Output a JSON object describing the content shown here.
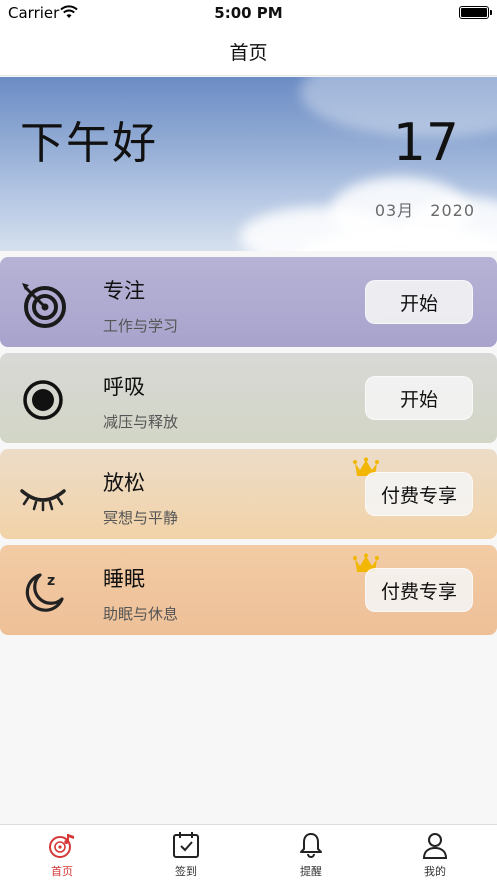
{
  "status_bar": {
    "carrier": "Carrier",
    "time": "5:00 PM"
  },
  "nav": {
    "title": "首页"
  },
  "hero": {
    "greeting": "下午好",
    "day": "17",
    "month": "03月",
    "year": "2020"
  },
  "cards": [
    {
      "title": "专注",
      "subtitle": "工作与学习",
      "button": "开始",
      "icon": "target-icon",
      "premium": false
    },
    {
      "title": "呼吸",
      "subtitle": "减压与释放",
      "button": "开始",
      "icon": "record-dot-icon",
      "premium": false
    },
    {
      "title": "放松",
      "subtitle": "冥想与平静",
      "button": "付费专享",
      "icon": "closed-eye-icon",
      "premium": true
    },
    {
      "title": "睡眠",
      "subtitle": "助眠与休息",
      "button": "付费专享",
      "icon": "moon-icon",
      "premium": true
    }
  ],
  "tabs": [
    {
      "label": "首页",
      "icon": "music-disc-icon",
      "active": true
    },
    {
      "label": "签到",
      "icon": "calendar-check-icon",
      "active": false
    },
    {
      "label": "提醒",
      "icon": "bell-icon",
      "active": false
    },
    {
      "label": "我的",
      "icon": "user-icon",
      "active": false
    }
  ],
  "colors": {
    "accent": "#d63838",
    "crown": "#f2b705"
  }
}
